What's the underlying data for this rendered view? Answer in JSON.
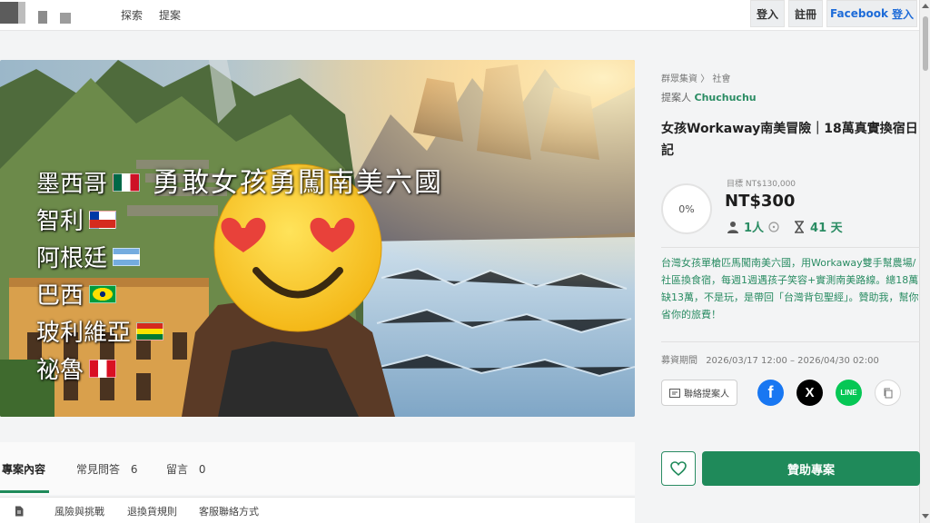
{
  "nav": {
    "explore_label": "探索",
    "propose_label": "提案",
    "login_label": "登入",
    "register_label": "註冊",
    "facebook_label": "Facebook",
    "facebook_login_label": "登入"
  },
  "hero": {
    "title": "勇敢女孩勇闖南美六國",
    "countries": [
      {
        "name": "墨西哥",
        "flag": "mexico"
      },
      {
        "name": "智利",
        "flag": "chile"
      },
      {
        "name": "阿根廷",
        "flag": "argentina"
      },
      {
        "name": "巴西",
        "flag": "brazil"
      },
      {
        "name": "玻利維亞",
        "flag": "bolivia"
      },
      {
        "name": "祕魯",
        "flag": "peru"
      }
    ]
  },
  "project": {
    "category": "群眾集資",
    "category_sep": "〉",
    "subcategory": "社會",
    "proposer_prefix": "提案人",
    "proposer_name": "Chuchuchu",
    "title": "女孩Workaway南美冒險｜18萬真實換宿日記",
    "percent": "0%",
    "goal": "目標 NT$130,000",
    "raised": "NT$300",
    "backers": "1人",
    "days_left": "41 天",
    "description": "台灣女孩單槍匹馬闖南美六國，用Workaway雙手幫農場/社區換食宿，每週1週遇孩子笑容+實測南美路線。總18萬缺13萬，不是玩，是帶回「台灣背包聖經」。贊助我，幫你省你的旅費！",
    "period_label": "募資期間",
    "period": "2026/03/17 12:00 – 2026/04/30 02:00",
    "contact_label": "聯絡提案人",
    "back_label": "贊助專案"
  },
  "tabs": [
    {
      "label": "專案內容",
      "count": ""
    },
    {
      "label": "常見問答",
      "count": "6"
    },
    {
      "label": "留言",
      "count": "0"
    }
  ],
  "sublinks": [
    "風險與挑戰",
    "退換貨規則",
    "客服聯絡方式"
  ],
  "colors": {
    "accent": "#1f8a5a",
    "facebook": "#1877f2",
    "line": "#06c755"
  }
}
